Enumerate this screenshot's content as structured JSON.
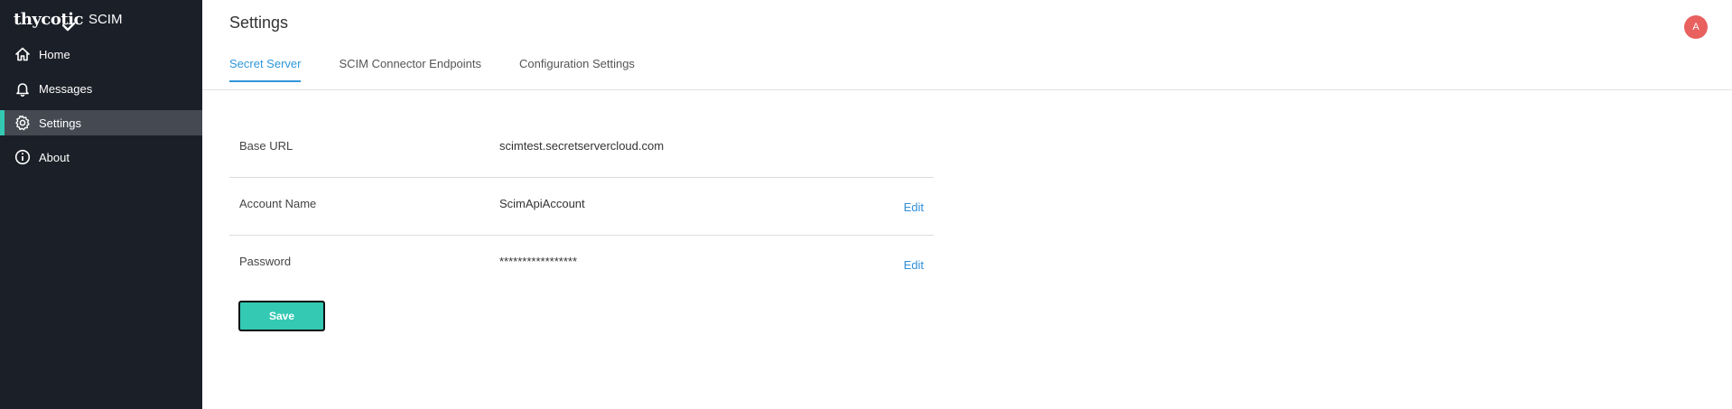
{
  "brand": {
    "logo_text": "thycotic",
    "product": "SCIM"
  },
  "sidebar": {
    "items": [
      {
        "label": "Home",
        "icon": "home-icon"
      },
      {
        "label": "Messages",
        "icon": "bell-icon"
      },
      {
        "label": "Settings",
        "icon": "gear-icon",
        "active": true
      },
      {
        "label": "About",
        "icon": "info-icon"
      }
    ]
  },
  "header": {
    "title": "Settings",
    "avatar_initial": "A",
    "tabs": [
      {
        "label": "Secret Server",
        "active": true
      },
      {
        "label": "SCIM Connector Endpoints"
      },
      {
        "label": "Configuration Settings"
      }
    ]
  },
  "settings": {
    "rows": [
      {
        "label": "Base URL",
        "value": "scimtest.secretservercloud.com"
      },
      {
        "label": "Account Name",
        "value": "ScimApiAccount",
        "action": "Edit"
      },
      {
        "label": "Password",
        "value": "*****************",
        "action": "Edit"
      }
    ]
  },
  "actions": {
    "save_label": "Save"
  },
  "colors": {
    "sidebar_bg": "#1b1f27",
    "active_item_bg": "#454a52",
    "accent_teal": "#33c9b3",
    "link_blue": "#2f97d9",
    "avatar_red": "#e8615f"
  }
}
